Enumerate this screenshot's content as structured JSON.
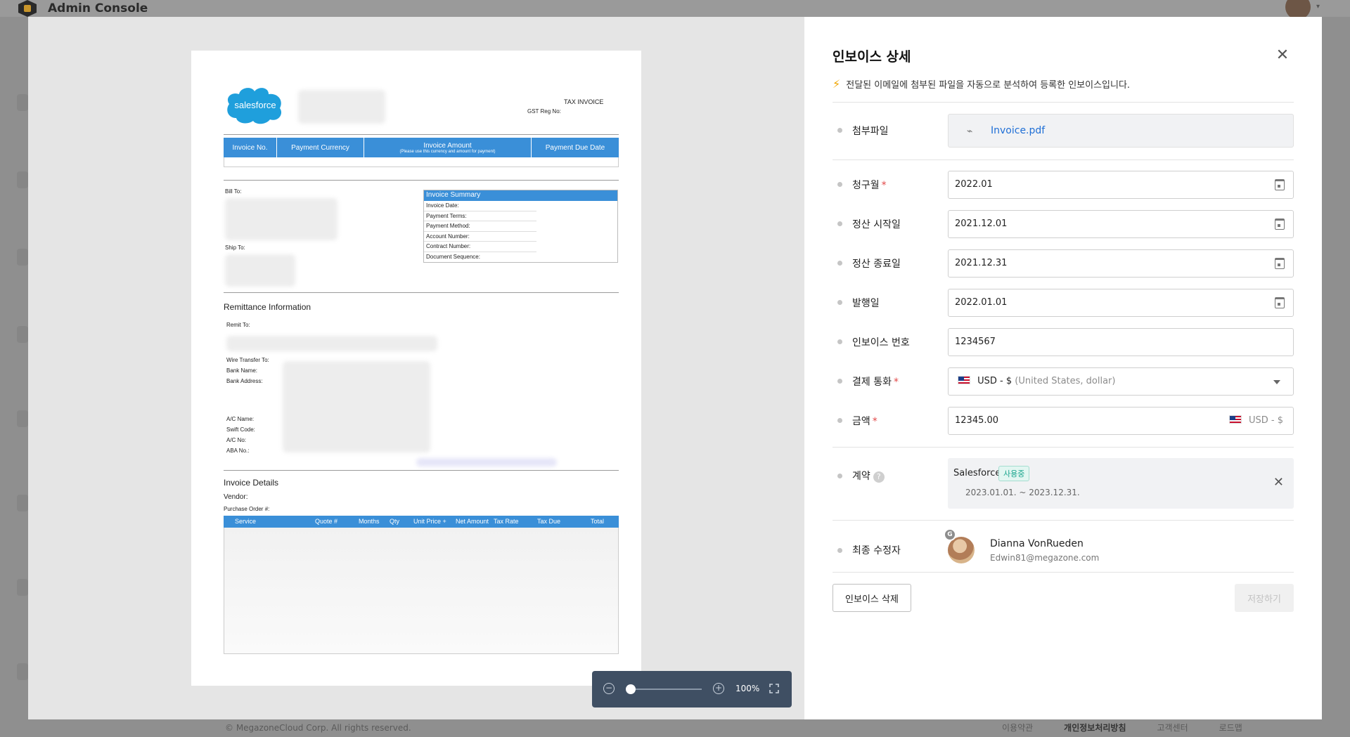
{
  "app": {
    "title": "Admin Console"
  },
  "footer": {
    "copyright": "© MegazoneCloud Corp. All rights reserved.",
    "terms": "이용약관",
    "privacy": "개인정보처리방침",
    "support": "고객센터",
    "roadmap": "로드맵"
  },
  "document": {
    "logo_text": "salesforce",
    "tax_invoice": "TAX INVOICE",
    "gst_reg": "GST Reg No:",
    "table_headers": [
      "Invoice No.",
      "Payment Currency",
      "Invoice Amount",
      "Payment Due Date"
    ],
    "amount_note": "(Please use this currency and amount for payment)",
    "bill_to": "Bill To:",
    "ship_to": "Ship To:",
    "summary_title": "Invoice Summary",
    "summary_rows": [
      "Invoice Date:",
      "Payment Terms:",
      "Payment Method:",
      "Account Number:",
      "Contract Number:",
      "Document Sequence:"
    ],
    "remittance_title": "Remittance Information",
    "remit_to": "Remit To:",
    "wire_labels": [
      "Wire Transfer To:",
      "Bank Name:",
      "Bank Address:"
    ],
    "ac_labels": [
      "A/C Name:",
      "Swift Code:",
      "A/C No:",
      "ABA No.:"
    ],
    "details_title": "Invoice Details",
    "vendor": "Vendor:",
    "po": "Purchase Order #:",
    "details_headers": [
      "Service",
      "Quote #",
      "Months",
      "Qty",
      "Unit Price +",
      "Net Amount",
      "Tax Rate",
      "Tax Due",
      "Total"
    ]
  },
  "zoom": {
    "level": "100%",
    "slider_value": 0
  },
  "panel": {
    "title": "인보이스 상세",
    "notice": "전달된 이메일에 첨부된 파일을 자동으로 분석하여 등록한 인보이스입니다.",
    "attachment": {
      "label": "첨부파일",
      "file": "Invoice.pdf"
    },
    "billing_month": {
      "label": "청구월",
      "value": "2022.01",
      "required": true
    },
    "settle_start": {
      "label": "정산 시작일",
      "value": "2021.12.01"
    },
    "settle_end": {
      "label": "정산 종료일",
      "value": "2021.12.31"
    },
    "issue_date": {
      "label": "발행일",
      "value": "2022.01.01"
    },
    "invoice_no": {
      "label": "인보이스 번호",
      "value": "1234567"
    },
    "currency": {
      "label": "결제 통화",
      "code": "USD - $",
      "name": "(United States, dollar)",
      "required": true
    },
    "amount": {
      "label": "금액",
      "value": "12345.00",
      "currency": "USD - $",
      "required": true
    },
    "contract": {
      "label": "계약",
      "name": "Salesforce",
      "status": "사용중",
      "period": "2023.01.01. ~ 2023.12.31."
    },
    "editor": {
      "label": "최종 수정자",
      "name": "Dianna VonRueden",
      "email": "Edwin81@megazone.com",
      "badge": "G"
    },
    "delete_label": "인보이스 삭제",
    "save_label": "저장하기"
  },
  "colors": {
    "accent": "#1f6fd6",
    "doc_blue": "#3a8fd8",
    "toolbar": "#3f4f63",
    "required": "#e24848",
    "badge_green": "#1aa58e"
  }
}
